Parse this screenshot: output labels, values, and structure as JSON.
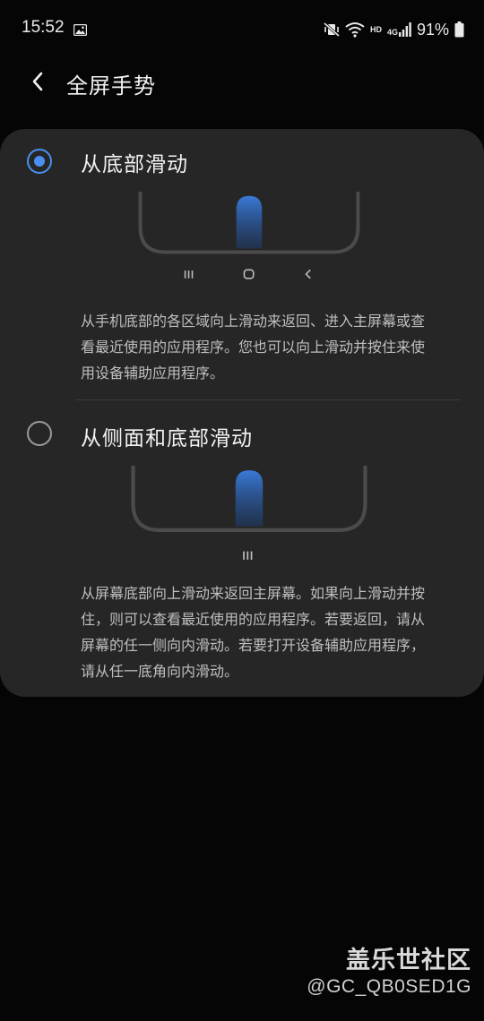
{
  "status_bar": {
    "time": "15:52",
    "network_label": "HD",
    "network_type": "4G",
    "battery": "91%",
    "icons": [
      "gallery-icon",
      "mute-vibrate-icon",
      "wifi-icon",
      "signal-icon",
      "battery-icon"
    ]
  },
  "header": {
    "title": "全屏手势",
    "back_icon": "chevron-left-icon"
  },
  "options": [
    {
      "title": "从底部滑动",
      "selected": true,
      "nav_icons": [
        "recents-icon",
        "home-icon",
        "back-icon"
      ],
      "description": "从手机底部的各区域向上滑动来返回、进入主屏幕或查看最近使用的应用程序。您也可以向上滑动并按住来使用设备辅助应用程序。"
    },
    {
      "title": "从侧面和底部滑动",
      "selected": false,
      "nav_icons": [
        "handle-icon"
      ],
      "description": "从屏幕底部向上滑动来返回主屏幕。如果向上滑动并按住，则可以查看最近使用的应用程序。若要返回，请从屏幕的任一侧向内滑动。若要打开设备辅助应用程序，请从任一底角向内滑动。"
    }
  ],
  "watermark": {
    "title": "盖乐世社区",
    "user_id": "@GC_QB0SED1G"
  },
  "colors": {
    "accent": "#4a8ff0",
    "card_background": "#262626",
    "page_background": "#050505",
    "gesture_gradient_top": "#3a7ad8",
    "gesture_gradient_bottom": "#1e3a66"
  }
}
